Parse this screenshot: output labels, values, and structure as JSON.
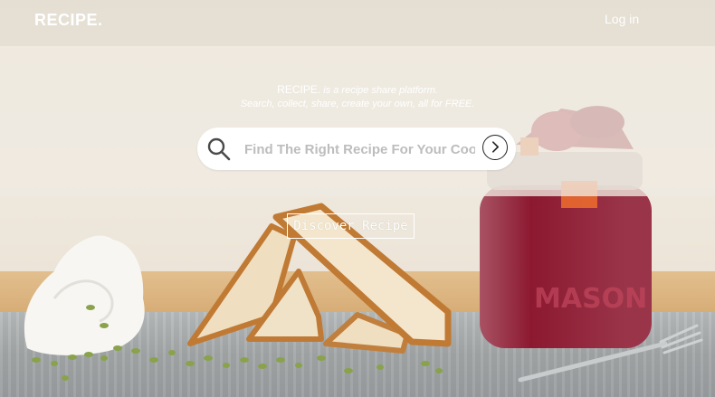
{
  "header": {
    "logo": "RECIPE.",
    "login_label": "Log in"
  },
  "hero": {
    "brand": "RECIPE.",
    "tagline_1": "is a recipe share platform.",
    "tagline_2": "Search, collect, share, create your own, all for FREE."
  },
  "search": {
    "placeholder": "Find The Right Recipe For Your Cook."
  },
  "cta": {
    "discover_label": "Discover Recipe"
  },
  "colors": {
    "text_on_image": "#ffffff",
    "search_bg": "#ffffff",
    "placeholder": "#bdbdbd"
  }
}
